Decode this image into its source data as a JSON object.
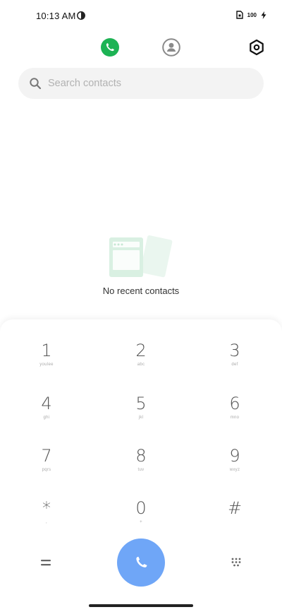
{
  "status_bar": {
    "time": "10:13 AM",
    "battery_level": "100"
  },
  "tabs": [
    {
      "name": "phone",
      "icon": "phone-icon",
      "active": true,
      "color": "#1db354"
    },
    {
      "name": "contacts",
      "icon": "person-icon",
      "active": false
    },
    {
      "name": "settings",
      "icon": "settings-icon",
      "active": false
    }
  ],
  "search": {
    "placeholder": "Search contacts",
    "value": ""
  },
  "empty_state": {
    "message": "No recent contacts",
    "illustration": "contact-cards-icon"
  },
  "dialpad": {
    "keys": [
      {
        "digit": "1",
        "letters": "youlee"
      },
      {
        "digit": "2",
        "letters": "abc"
      },
      {
        "digit": "3",
        "letters": "def"
      },
      {
        "digit": "4",
        "letters": "ghi"
      },
      {
        "digit": "5",
        "letters": "jkl"
      },
      {
        "digit": "6",
        "letters": "mno"
      },
      {
        "digit": "7",
        "letters": "pqrs"
      },
      {
        "digit": "8",
        "letters": "tuv"
      },
      {
        "digit": "9",
        "letters": "wxyz"
      },
      {
        "digit": "*",
        "letters": ","
      },
      {
        "digit": "0",
        "letters": "+"
      },
      {
        "digit": "#",
        "letters": ""
      }
    ],
    "call_button_color": "#6fa6f7",
    "left_action_icon": "menu-icon",
    "right_action_icon": "dialpad-icon"
  }
}
